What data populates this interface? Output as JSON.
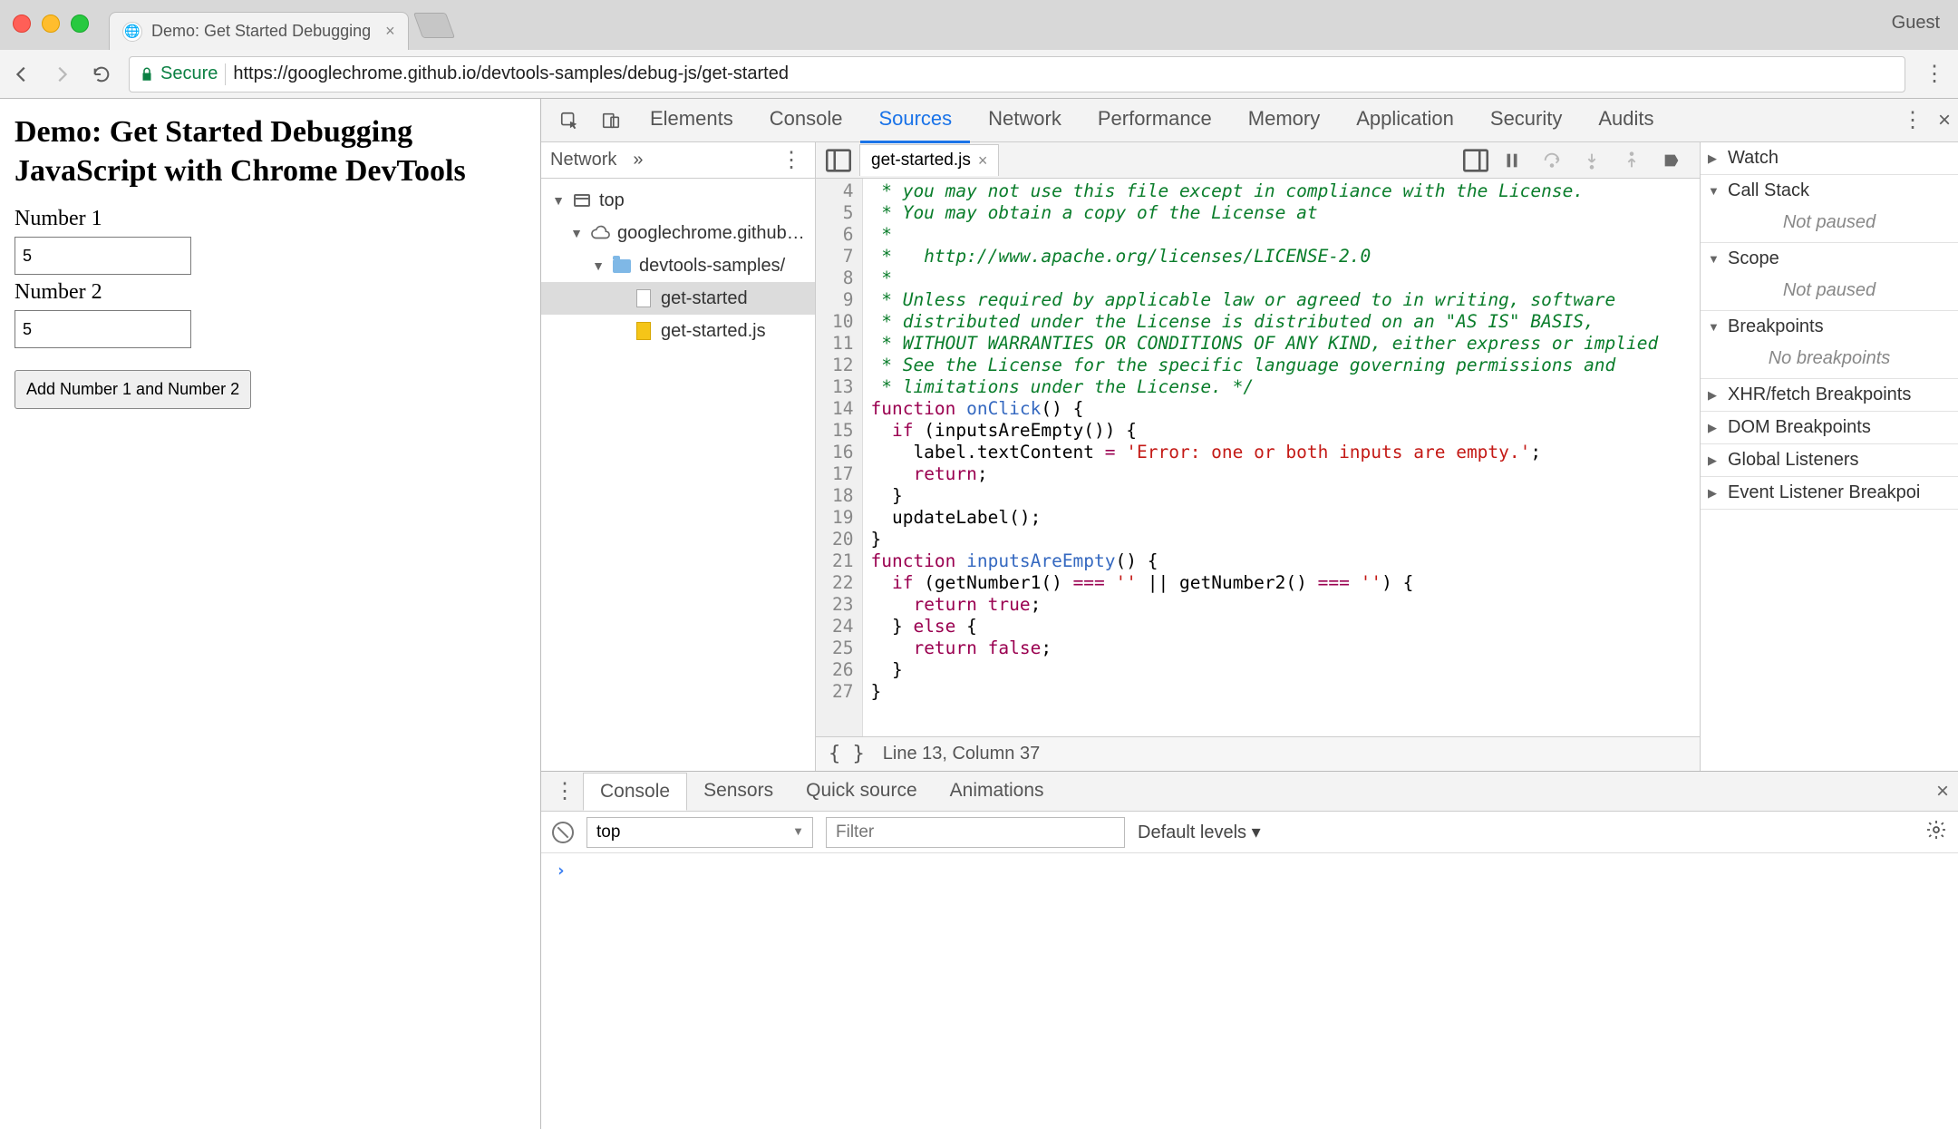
{
  "browser": {
    "tab_title": "Demo: Get Started Debugging",
    "guest_label": "Guest",
    "secure_label": "Secure",
    "url_display": "https://googlechrome.github.io/devtools-samples/debug-js/get-started"
  },
  "page": {
    "heading": "Demo: Get Started Debugging JavaScript with Chrome DevTools",
    "number1_label": "Number 1",
    "number1_value": "5",
    "number2_label": "Number 2",
    "number2_value": "5",
    "add_button_label": "Add Number 1 and Number 2"
  },
  "devtools": {
    "panels": [
      "Elements",
      "Console",
      "Sources",
      "Network",
      "Performance",
      "Memory",
      "Application",
      "Security",
      "Audits"
    ],
    "active_panel": "Sources",
    "navigator": {
      "view_label": "Network",
      "tree": {
        "top_label": "top",
        "origin_label": "googlechrome.github…",
        "folder_label": "devtools-samples/",
        "files": [
          "get-started",
          "get-started.js"
        ],
        "selected": "get-started"
      }
    },
    "editor": {
      "open_file": "get-started.js",
      "first_line_no": 4,
      "lines": [
        {
          "type": "comment",
          "text": " * you may not use this file except in compliance with the License."
        },
        {
          "type": "comment",
          "text": " * You may obtain a copy of the License at"
        },
        {
          "type": "comment",
          "text": " *"
        },
        {
          "type": "comment",
          "text": " *   http://www.apache.org/licenses/LICENSE-2.0"
        },
        {
          "type": "comment",
          "text": " *"
        },
        {
          "type": "comment",
          "text": " * Unless required by applicable law or agreed to in writing, software"
        },
        {
          "type": "comment",
          "text": " * distributed under the License is distributed on an \"AS IS\" BASIS,"
        },
        {
          "type": "comment",
          "text": " * WITHOUT WARRANTIES OR CONDITIONS OF ANY KIND, either express or implied"
        },
        {
          "type": "comment",
          "text": " * See the License for the specific language governing permissions and"
        },
        {
          "type": "comment",
          "text": " * limitations under the License. */"
        },
        {
          "type": "code",
          "tokens": [
            [
              "kw",
              "function "
            ],
            [
              "fname",
              "onClick"
            ],
            [
              "p",
              "() {"
            ]
          ]
        },
        {
          "type": "code",
          "tokens": [
            [
              "p",
              "  "
            ],
            [
              "kw",
              "if"
            ],
            [
              "p",
              " (inputsAreEmpty()) {"
            ]
          ]
        },
        {
          "type": "code",
          "tokens": [
            [
              "p",
              "    label.textContent "
            ],
            [
              "op",
              "="
            ],
            [
              "p",
              " "
            ],
            [
              "str",
              "'Error: one or both inputs are empty.'"
            ],
            [
              "p",
              ";"
            ]
          ]
        },
        {
          "type": "code",
          "tokens": [
            [
              "p",
              "    "
            ],
            [
              "kw",
              "return"
            ],
            [
              "p",
              ";"
            ]
          ]
        },
        {
          "type": "code",
          "tokens": [
            [
              "p",
              "  }"
            ]
          ]
        },
        {
          "type": "code",
          "tokens": [
            [
              "p",
              "  updateLabel();"
            ]
          ]
        },
        {
          "type": "code",
          "tokens": [
            [
              "p",
              "}"
            ]
          ]
        },
        {
          "type": "code",
          "tokens": [
            [
              "kw",
              "function "
            ],
            [
              "fname",
              "inputsAreEmpty"
            ],
            [
              "p",
              "() {"
            ]
          ]
        },
        {
          "type": "code",
          "tokens": [
            [
              "p",
              "  "
            ],
            [
              "kw",
              "if"
            ],
            [
              "p",
              " (getNumber1() "
            ],
            [
              "op",
              "==="
            ],
            [
              "p",
              " "
            ],
            [
              "str",
              "''"
            ],
            [
              "p",
              " || getNumber2() "
            ],
            [
              "op",
              "==="
            ],
            [
              "p",
              " "
            ],
            [
              "str",
              "''"
            ],
            [
              "p",
              ") {"
            ]
          ]
        },
        {
          "type": "code",
          "tokens": [
            [
              "p",
              "    "
            ],
            [
              "kw",
              "return"
            ],
            [
              "p",
              " "
            ],
            [
              "bool",
              "true"
            ],
            [
              "p",
              ";"
            ]
          ]
        },
        {
          "type": "code",
          "tokens": [
            [
              "p",
              "  } "
            ],
            [
              "kw",
              "else"
            ],
            [
              "p",
              " {"
            ]
          ]
        },
        {
          "type": "code",
          "tokens": [
            [
              "p",
              "    "
            ],
            [
              "kw",
              "return"
            ],
            [
              "p",
              " "
            ],
            [
              "bool",
              "false"
            ],
            [
              "p",
              ";"
            ]
          ]
        },
        {
          "type": "code",
          "tokens": [
            [
              "p",
              "  }"
            ]
          ]
        },
        {
          "type": "code",
          "tokens": [
            [
              "p",
              "}"
            ]
          ]
        }
      ],
      "status": "Line 13, Column 37"
    },
    "debugger": {
      "sections": [
        {
          "name": "Watch",
          "expanded": false
        },
        {
          "name": "Call Stack",
          "expanded": true,
          "body": "Not paused"
        },
        {
          "name": "Scope",
          "expanded": true,
          "body": "Not paused"
        },
        {
          "name": "Breakpoints",
          "expanded": true,
          "body": "No breakpoints"
        },
        {
          "name": "XHR/fetch Breakpoints",
          "expanded": false
        },
        {
          "name": "DOM Breakpoints",
          "expanded": false
        },
        {
          "name": "Global Listeners",
          "expanded": false
        },
        {
          "name": "Event Listener Breakpoi",
          "expanded": false
        }
      ]
    },
    "drawer": {
      "tabs": [
        "Console",
        "Sensors",
        "Quick source",
        "Animations"
      ],
      "active": "Console",
      "context": "top",
      "filter_placeholder": "Filter",
      "levels_label": "Default levels"
    }
  }
}
